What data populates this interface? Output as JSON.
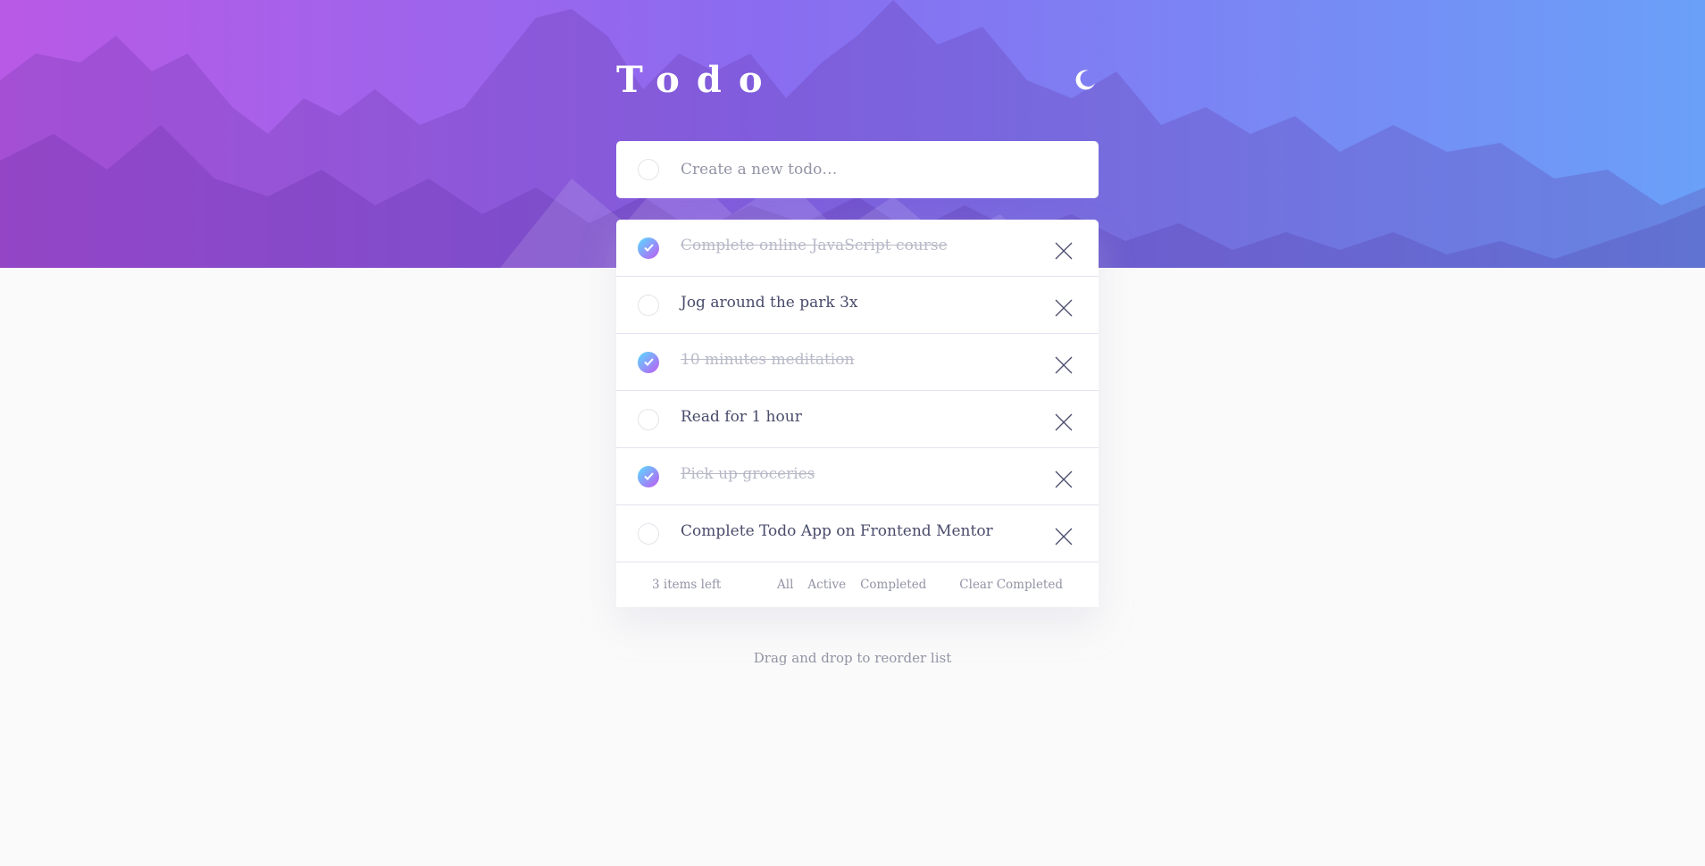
{
  "app": {
    "title": "Todo"
  },
  "new_todo": {
    "placeholder": "Create a new todo…"
  },
  "todos": [
    {
      "text": "Complete online JavaScript course",
      "completed": true
    },
    {
      "text": "Jog around the park 3x",
      "completed": false
    },
    {
      "text": "10 minutes meditation",
      "completed": true
    },
    {
      "text": "Read for 1 hour",
      "completed": false
    },
    {
      "text": "Pick up groceries",
      "completed": true
    },
    {
      "text": "Complete Todo App on Frontend Mentor",
      "completed": false
    }
  ],
  "footer": {
    "items_left": "3 items left",
    "filter_all": "All",
    "filter_active": "Active",
    "filter_completed": "Completed",
    "clear_completed": "Clear Completed"
  },
  "hint": "Drag and drop to reorder list",
  "colors": {
    "gradient_start": "#57ddff",
    "gradient_end": "#c058f3",
    "text": "#494c6b",
    "muted": "#9394a5",
    "background": "#fafafa"
  },
  "icons": {
    "theme_toggle": "moon-icon",
    "delete": "cross-icon",
    "check": "check-icon"
  }
}
